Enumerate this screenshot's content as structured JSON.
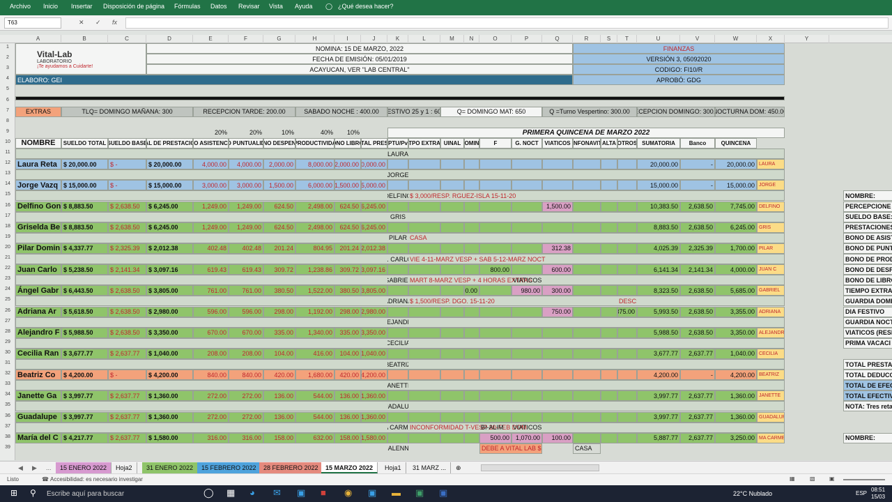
{
  "ribbon": {
    "menu": [
      "Archivo",
      "Inicio",
      "Insertar",
      "Disposición de página",
      "Fórmulas",
      "Datos",
      "Revisar",
      "Vista",
      "Ayuda"
    ],
    "search": "¿Qué desea hacer?"
  },
  "formula_bar": {
    "cell_ref": "T63"
  },
  "column_headers": [
    "A",
    "B",
    "C",
    "D",
    "E",
    "F",
    "G",
    "H",
    "I",
    "J",
    "K",
    "L",
    "M",
    "N",
    "O",
    "P",
    "Q",
    "R",
    "S",
    "T",
    "U",
    "V",
    "W",
    "X",
    "Y"
  ],
  "header": {
    "logo_name": "Vital-Lab",
    "logo_sub": "LABORATORIO",
    "logo_slogan": "¡Te ayudamos a Cuidarte!",
    "nomina": "NOMINA: 15 DE MARZO, 2022",
    "emision": "FECHA DE EMISIÓN: 05/01/2019",
    "lugar": "ACAYUCAN, VER \"LAB CENTRAL\"",
    "elaboro": "ELABORO: GEI",
    "finanzas": "FINANZAS",
    "version": "VERSIÓN 3, 05092020",
    "codigo": "CODIGO: FI10/R",
    "aprobo": "APROBÓ: GDG"
  },
  "extras": [
    "EXTRAS",
    "TLQ= DOMINGO MAÑANA: 300",
    "RECEPCION TARDE: 200.00",
    "SABADO NOCHE : 400.00",
    "FESTIVO 25 y 1 : 600",
    "Q= DOMINGO MAT: 650",
    "Q =Turno Vespertino: 300.00",
    "RECEPCION DOMINGO: 300.00",
    "NOCTURNA DOM: 450.00"
  ],
  "percents": [
    "20%",
    "20%",
    "10%",
    "40%",
    "10%"
  ],
  "period_title": "PRIMERA QUINCENA DE MARZO 2022",
  "table_headers": [
    "NOMBRE",
    "SUELDO TOTAL",
    "SUELDO BASE",
    "AL DE PRESTACIO",
    "O ASISTENC",
    "O PUNTUALID",
    "NO DESPEN",
    "PRODUCTIVIDA",
    "ONO LIBRO",
    "TOTAL PRESTA",
    "PTU/Pv",
    "TPO EXTRA",
    "UINAL",
    "OMIN",
    "F",
    "G. NOCT",
    "VIATICOS",
    "INFONAVIT",
    "ALTA",
    "OTROS",
    "SUMATORIA",
    "Banco",
    "QUINCENA"
  ],
  "employees": [
    {
      "name": "Laura Reta",
      "total": "$ 20,000.00",
      "base": "$   -",
      "prest": "$ 20,000.00",
      "asist": "4,000.00",
      "punt": "4,000.00",
      "desp": "2,000.00",
      "prod": "8,000.00",
      "libro": "2,000.00",
      "tot": "20,000.00",
      "tag": "LAURA",
      "note": "",
      "suma": "20,000.00",
      "banco": "-",
      "quincena": "20,000.00",
      "short": "LAURA",
      "cls": "lb"
    },
    {
      "name": "Jorge Vazq",
      "total": "$ 15,000.00",
      "base": "$   -",
      "prest": "$ 15,000.00",
      "asist": "3,000.00",
      "punt": "3,000.00",
      "desp": "1,500.00",
      "prod": "6,000.00",
      "libro": "1,500.00",
      "tot": "15,000.00",
      "tag": "JORGE",
      "note": "",
      "suma": "15,000.00",
      "banco": "-",
      "quincena": "15,000.00",
      "short": "JORGE",
      "cls": "lb"
    },
    {
      "name": "Delfino Gon",
      "total": "$ 8,883.50",
      "base": "$ 2,638.50",
      "prest": "$ 6,245.00",
      "asist": "1,249.00",
      "punt": "1,249.00",
      "desp": "624.50",
      "prod": "2,498.00",
      "libro": "624.50",
      "tot": "6,245.00",
      "tag": "DELFINO",
      "note": "$ 3,000/RESP. RGUEZ-ISLA 15-11-20",
      "extra": "1,500.00",
      "suma": "10,383.50",
      "banco": "2,638.50",
      "quincena": "7,745.00",
      "short": "DELFINO",
      "cls": "g"
    },
    {
      "name": "Griselda Be",
      "total": "$ 8,883.50",
      "base": "$ 2,638.50",
      "prest": "$ 6,245.00",
      "asist": "1,249.00",
      "punt": "1,249.00",
      "desp": "624.50",
      "prod": "2,498.00",
      "libro": "624.50",
      "tot": "6,245.00",
      "tag": "GRIS",
      "note": "",
      "suma": "8,883.50",
      "banco": "2,638.50",
      "quincena": "6,245.00",
      "short": "GRIS",
      "cls": "g"
    },
    {
      "name": "Pilar Domin",
      "total": "$ 4,337.77",
      "base": "$ 2,325.39",
      "prest": "$ 2,012.38",
      "asist": "402.48",
      "punt": "402.48",
      "desp": "201.24",
      "prod": "804.95",
      "libro": "201.24",
      "tot": "2,012.38",
      "tag": "PILAR",
      "note": "CASA",
      "extra": "312.38",
      "suma": "4,025.39",
      "banco": "2,325.39",
      "quincena": "1,700.00",
      "short": "PILAR",
      "cls": "g"
    },
    {
      "name": "Juan Carlo",
      "total": "$ 5,238.50",
      "base": "$ 2,141.34",
      "prest": "$ 3,097.16",
      "asist": "619.43",
      "punt": "619.43",
      "desp": "309.72",
      "prod": "1,238.86",
      "libro": "309.72",
      "tot": "3,097.16",
      "tag": "J. CARLO",
      "note": "VIE 4-11-MARZ VESP + SAB 5-12-MARZ NOCT",
      "extra": "600.00",
      "suma": "6,141.34",
      "banco": "2,141.34",
      "quincena": "4,000.00",
      "short": "JUAN C",
      "cls": "g"
    },
    {
      "name": "Ángel Gabr",
      "total": "$ 6,443.50",
      "base": "$ 2,638.50",
      "prest": "$ 3,805.00",
      "asist": "761.00",
      "punt": "761.00",
      "desp": "380.50",
      "prod": "1,522.00",
      "libro": "380.50",
      "tot": "3,805.00",
      "tag": "GABRIEL",
      "note": "MART 8-MARZ VESP + 4 HORAS EXTRAS",
      "extra": "300.00",
      "suma": "8,323.50",
      "banco": "2,638.50",
      "quincena": "5,685.00",
      "short": "GABRIEL",
      "cls": "g"
    },
    {
      "name": "Adriana Ar",
      "total": "$ 5,618.50",
      "base": "$ 2,638.50",
      "prest": "$ 2,980.00",
      "asist": "596.00",
      "punt": "596.00",
      "desp": "298.00",
      "prod": "1,192.00",
      "libro": "298.00",
      "tot": "2,980.00",
      "tag": "ADRIANA",
      "note": "$ 1,500/RESP. DGO. 15-11-20",
      "extra": "750.00",
      "suma": "5,993.50",
      "banco": "2,638.50",
      "quincena": "3,355.00",
      "short": "ADRIANA",
      "cls": "g"
    },
    {
      "name": "Alejandro F",
      "total": "$ 5,988.50",
      "base": "$ 2,638.50",
      "prest": "$ 3,350.00",
      "asist": "670.00",
      "punt": "670.00",
      "desp": "335.00",
      "prod": "1,340.00",
      "libro": "335.00",
      "tot": "3,350.00",
      "tag": "ALEJANDRO",
      "note": "",
      "suma": "5,988.50",
      "banco": "2,638.50",
      "quincena": "3,350.00",
      "short": "ALEJANDRO",
      "cls": "g"
    },
    {
      "name": "Cecilia Ran",
      "total": "$ 3,677.77",
      "base": "$ 2,637.77",
      "prest": "$ 1,040.00",
      "asist": "208.00",
      "punt": "208.00",
      "desp": "104.00",
      "prod": "416.00",
      "libro": "104.00",
      "tot": "1,040.00",
      "tag": "CECILIA",
      "note": "",
      "suma": "3,677.77",
      "banco": "2,637.77",
      "quincena": "1,040.00",
      "short": "CECILIA",
      "cls": "g"
    },
    {
      "name": "Beatriz Co",
      "total": "$ 4,200.00",
      "base": "$   -",
      "prest": "$ 4,200.00",
      "asist": "840.00",
      "punt": "840.00",
      "desp": "420.00",
      "prod": "1,680.00",
      "libro": "420.00",
      "tot": "4,200.00",
      "tag": "BEATRIZ",
      "note": "",
      "suma": "4,200.00",
      "banco": "-",
      "quincena": "4,200.00",
      "short": "BEATRIZ",
      "cls": "or"
    },
    {
      "name": "Janette Ga",
      "total": "$ 3,997.77",
      "base": "$ 2,637.77",
      "prest": "$ 1,360.00",
      "asist": "272.00",
      "punt": "272.00",
      "desp": "136.00",
      "prod": "544.00",
      "libro": "136.00",
      "tot": "1,360.00",
      "tag": "JANETTE",
      "note": "",
      "suma": "3,997.77",
      "banco": "2,637.77",
      "quincena": "1,360.00",
      "short": "JANETTE",
      "cls": "g"
    },
    {
      "name": "Guadalupe",
      "total": "$ 3,997.77",
      "base": "$ 2,637.77",
      "prest": "$ 1,360.00",
      "asist": "272.00",
      "punt": "272.00",
      "desp": "136.00",
      "prod": "544.00",
      "libro": "136.00",
      "tot": "1,360.00",
      "tag": "GUADALUPE",
      "note": "",
      "suma": "3,997.77",
      "banco": "2,637.77",
      "quincena": "1,360.00",
      "short": "GUADALUPE",
      "cls": "g"
    },
    {
      "name": "María del C",
      "total": "$ 4,217.77",
      "base": "$ 2,637.77",
      "prest": "$ 1,580.00",
      "asist": "316.00",
      "punt": "316.00",
      "desp": "158.00",
      "prod": "632.00",
      "libro": "158.00",
      "tot": "1,580.00",
      "tag": "MA CARMEN",
      "note": "INCONFORMIDAD T-VESP 20-FEB DOM",
      "extra": "100.00",
      "suma": "5,887.77",
      "banco": "2,637.77",
      "quincena": "3,250.00",
      "short": "MA CARMEN",
      "cls": "g"
    }
  ],
  "notes": {
    "desc_marzo": "DESC: 8-MARZO",
    "desc_val": "375.00",
    "viaticos": "VIATICOS",
    "viaticos_val": "980.00",
    "g_noct_j": "800.00",
    "g_noct_g": "600.00",
    "bi_alim": "BI-ALIM",
    "bi_val": "500.00",
    "viat_m": "1,070.00",
    "malenny": "MALENNY",
    "debe": "DEBE A VITAL LAB $ 840",
    "casa": "CASA"
  },
  "side_panel": [
    "NOMBRE:",
    "PERCEPCIONE",
    "SUELDO BASE:",
    "PRESTACIONES",
    "BONO DE ASIST",
    "BONO DE PUNT",
    "BONO DE PROD",
    "BONO DE DESP",
    "BONO DE LIBRO",
    "TIEMPO EXTRA",
    "GUARDIA DOMING",
    "DIA FESTIVO",
    "GUARDIA NOCT",
    "VIATICOS (RESP.",
    "PRIMA VACACI",
    "",
    "TOTAL PRESTA",
    "TOTAL DEDUCC",
    "TOTAL DE EFEC",
    "TOTAL EFECTIVO",
    "NOTA: Tres retard",
    "",
    "",
    "NOMBRE:"
  ],
  "sheet_tabs": [
    "15 ENERO 2022",
    "Hoja2",
    "31 ENERO 2022",
    "15 FEBRERO 2022",
    "28 FEBRERO 2022",
    "15 MARZO 2022",
    "Hoja1",
    "31 MARZ ..."
  ],
  "status": {
    "ready": "Listo",
    "accessibility": "Accesibilidad: es necesario investigar"
  },
  "taskbar": {
    "search": "Escribe aquí para buscar",
    "weather": "22°C  Nublado",
    "lang": "ESP",
    "time": "08:51",
    "date": "15/03"
  }
}
